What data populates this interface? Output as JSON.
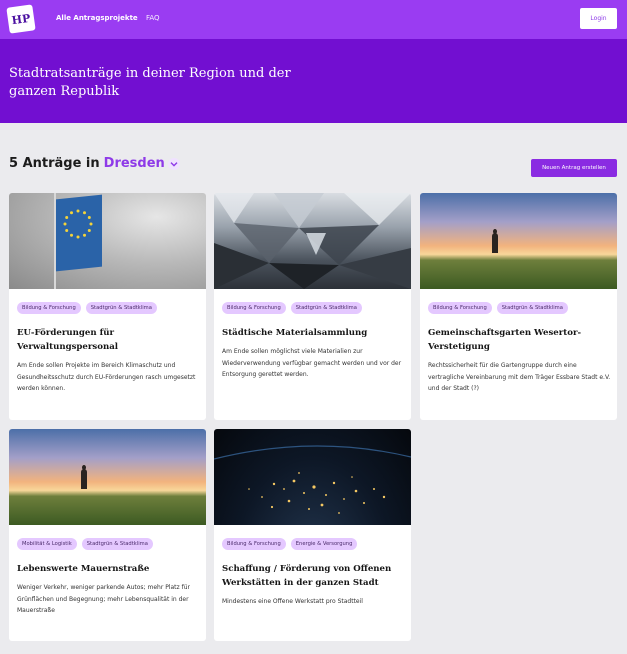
{
  "header": {
    "logo_text": "HP",
    "nav": [
      {
        "label": "Alle Antragsprojekte"
      },
      {
        "label": "FAQ"
      }
    ],
    "login_label": "Login"
  },
  "hero": {
    "title": "Stadtratsanträge in deiner Region und der ganzen Republik"
  },
  "listing": {
    "count_text": "5 Anträge in",
    "city": "Dresden",
    "new_button_label": "Neuen Antrag erstellen"
  },
  "cards": [
    {
      "image": "eu-flag-photo",
      "tags": [
        "Bildung & Forschung",
        "Stadtgrün & Stadtklima"
      ],
      "title": "EU-Förderungen für Verwaltungspersonal",
      "description": "Am Ende sollen Projekte im Bereich Klimaschutz und Gesundheitsschutz durch EU-Förderungen rasch umgesetzt werden können."
    },
    {
      "image": "mirror-architecture-photo",
      "tags": [
        "Bildung & Forschung",
        "Stadtgrün & Stadtklima"
      ],
      "title": "Städtische Materialsammlung",
      "description": "Am Ende sollen möglichst viele Materialien zur Wiederverwendung verfügbar gemacht werden und vor der Entsorgung gerettet werden."
    },
    {
      "image": "field-sunset-photo",
      "tags": [
        "Bildung & Forschung",
        "Stadtgrün & Stadtklima"
      ],
      "title": "Gemeinschaftsgarten Wesertor-Verstetigung",
      "description": "Rechtssicherheit für die Gartengruppe durch eine vertragliche Vereinbarung mit dem Träger Essbare Stadt e.V. und der Stadt (?)"
    },
    {
      "image": "field-sunset-photo",
      "tags": [
        "Mobilität & Logistik",
        "Stadtgrün & Stadtklima"
      ],
      "title": "Lebenswerte Mauernstraße",
      "description": "Weniger Verkehr, weniger parkende Autos; mehr Platz für Grünflächen und Begegnung; mehr Lebensqualität in der Mauerstraße"
    },
    {
      "image": "earth-at-night-photo",
      "tags": [
        "Bildung & Forschung",
        "Energie & Versorgung"
      ],
      "title": "Schaffung / Förderung von Offenen Werkstätten in der ganzen Stadt",
      "description": "Mindestens eine Offene Werkstatt pro Stadtteil"
    }
  ]
}
